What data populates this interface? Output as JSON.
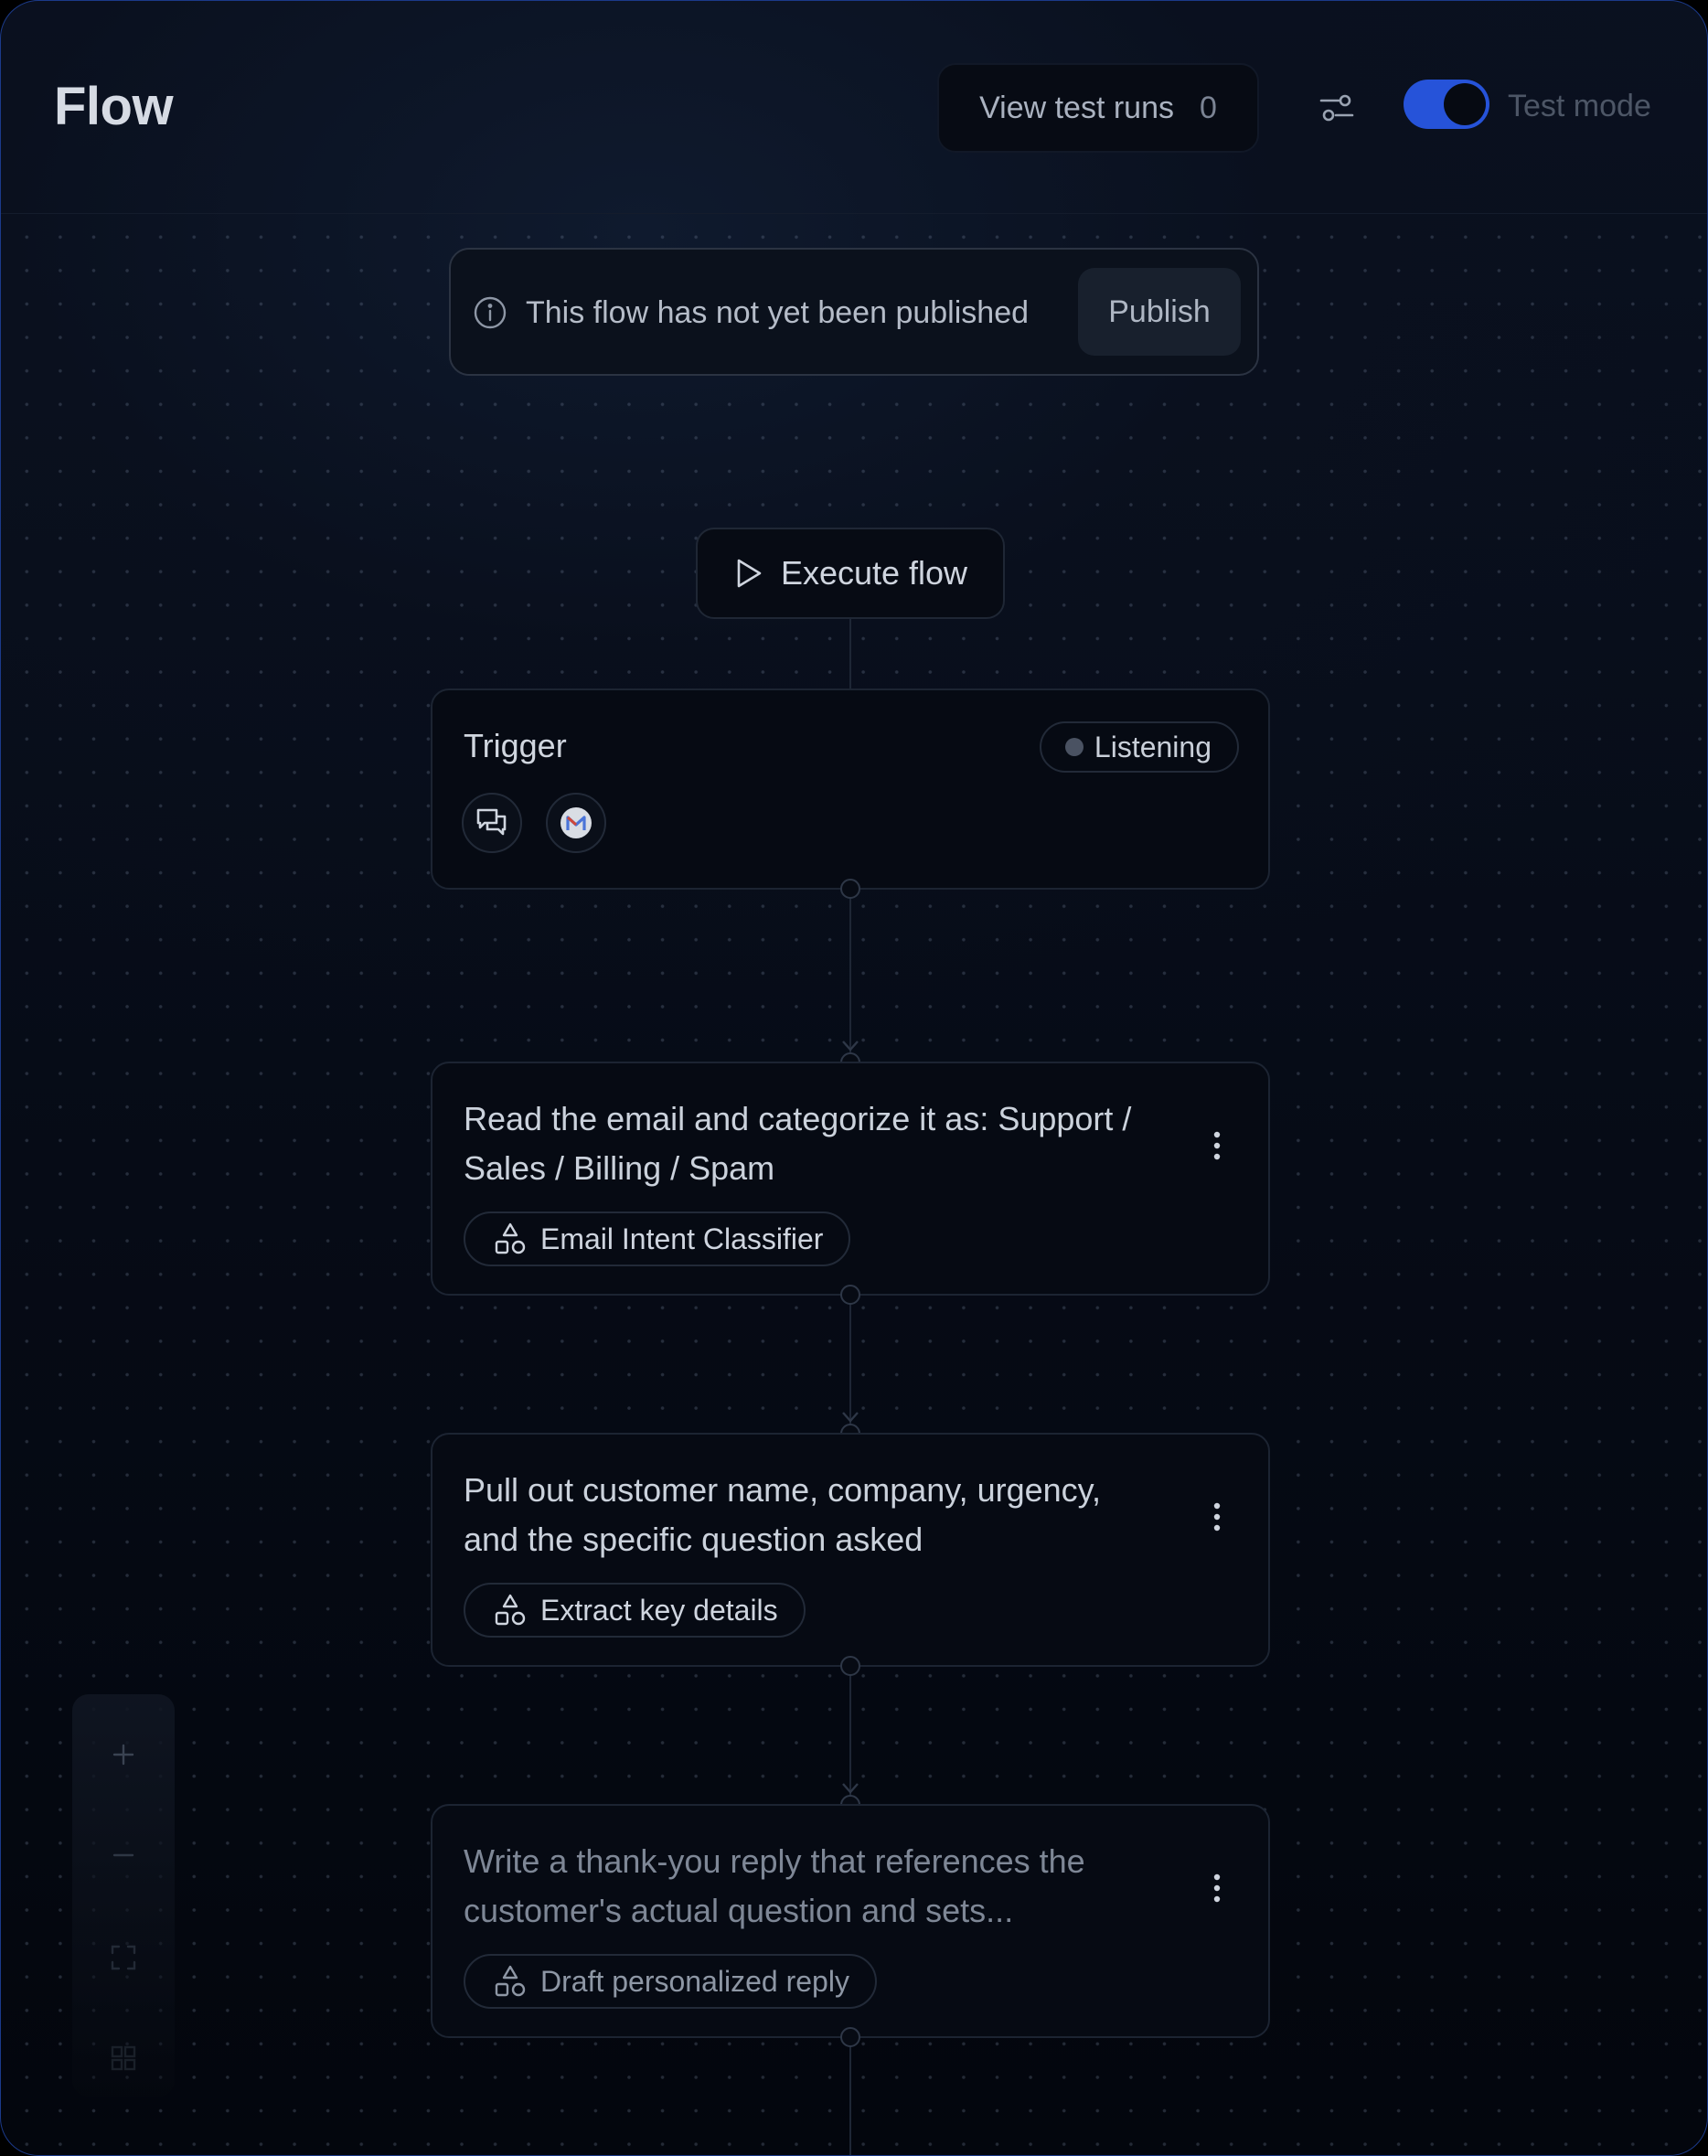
{
  "header": {
    "title": "Flow",
    "view_test_runs_label": "View test runs",
    "test_runs_count": "0",
    "test_mode_label": "Test mode",
    "test_mode_on": true
  },
  "banner": {
    "message": "This flow has not yet been published",
    "publish_label": "Publish"
  },
  "execute": {
    "label": "Execute flow"
  },
  "trigger": {
    "title": "Trigger",
    "status": "Listening",
    "icons": [
      "chat-bubbles-icon",
      "gmail-icon"
    ]
  },
  "steps": [
    {
      "text": "Read the email and categorize it as: Support / Sales / Billing / Spam",
      "chip": "Email Intent Classifier"
    },
    {
      "text": "Pull out customer name, company, urgency, and the specific question asked",
      "chip": "Extract key details"
    },
    {
      "text": "Write a thank-you reply that references the customer's actual question and sets...",
      "chip": "Draft personalized reply"
    }
  ],
  "zoom_controls": [
    "zoom-in-icon",
    "zoom-out-icon",
    "fit-view-icon",
    "minimap-icon"
  ],
  "colors": {
    "accent": "#2653d9",
    "background": "#070b14",
    "border": "#1c2432"
  }
}
